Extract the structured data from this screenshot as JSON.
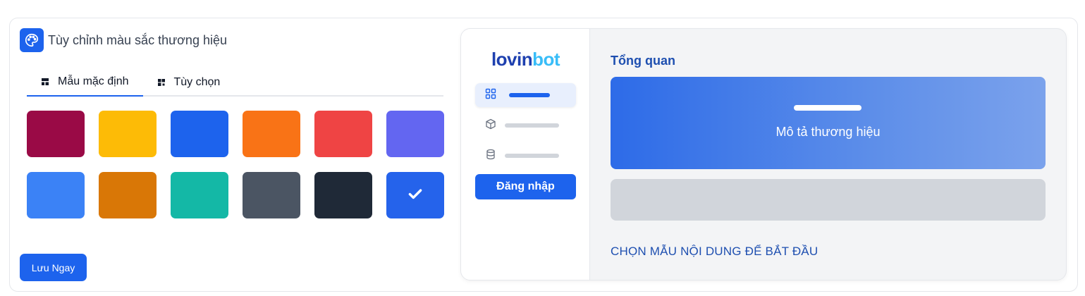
{
  "header": {
    "title": "Tùy chỉnh màu sắc thương hiệu",
    "icon": "palette-icon"
  },
  "tabs": [
    {
      "label": "Mẫu mặc định",
      "icon": "layout-icon",
      "active": true
    },
    {
      "label": "Tùy chọn",
      "icon": "grid-icon",
      "active": false
    }
  ],
  "swatches": [
    {
      "color": "#9a0a46",
      "selected": false
    },
    {
      "color": "#fdbb06",
      "selected": false
    },
    {
      "color": "#1d63ed",
      "selected": false
    },
    {
      "color": "#f97316",
      "selected": false
    },
    {
      "color": "#ef4444",
      "selected": false
    },
    {
      "color": "#6366f1",
      "selected": false
    },
    {
      "color": "#3b82f6",
      "selected": false
    },
    {
      "color": "#d97706",
      "selected": false
    },
    {
      "color": "#14b8a6",
      "selected": false
    },
    {
      "color": "#4b5563",
      "selected": false
    },
    {
      "color": "#1f2937",
      "selected": false
    },
    {
      "color": "#2563eb",
      "selected": true
    }
  ],
  "save_button": {
    "label": "Lưu Ngay"
  },
  "preview": {
    "logo": {
      "part1": "lov",
      "part2": "i",
      "part3": "n",
      "part4": "bot"
    },
    "nav": [
      {
        "icon": "dashboard-icon",
        "active": true
      },
      {
        "icon": "box-icon",
        "active": false
      },
      {
        "icon": "database-icon",
        "active": false
      }
    ],
    "login_button": "Đăng nhập",
    "title": "Tổng quan",
    "hero_text": "Mô tả thương hiệu",
    "cta": "CHỌN MẪU NỘI DUNG ĐỂ BẮT ĐẦU"
  },
  "colors": {
    "accent": "#1d63ed",
    "heading": "#1e4fb0",
    "logo_dark": "#1e40af",
    "logo_light": "#38bdf8"
  }
}
